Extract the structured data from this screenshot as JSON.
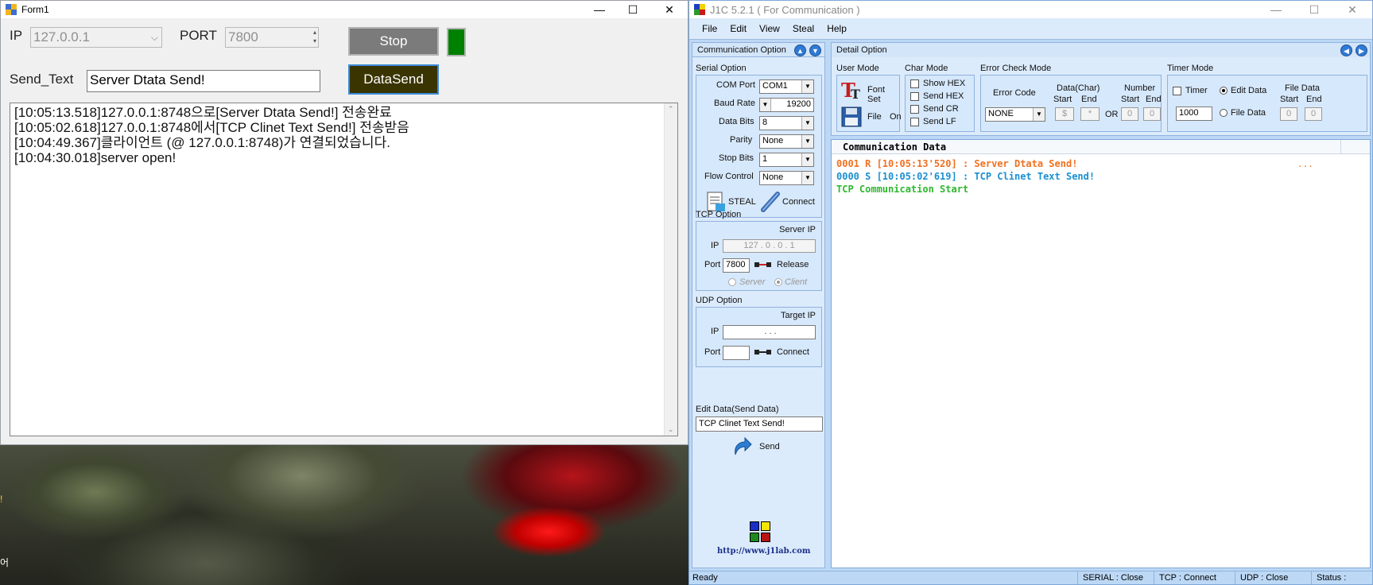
{
  "form1": {
    "title": "Form1",
    "controls": {
      "minimize": "—",
      "maximize": "☐",
      "close": "✕"
    },
    "ip_label": "IP",
    "ip_value": "127.0.0.1",
    "port_label": "PORT",
    "port_value": "7800",
    "stop_label": "Stop",
    "send_text_label": "Send_Text",
    "send_text_value": "Server Dtata Send!",
    "datasend_label": "DataSend",
    "log": [
      "[10:05:13.518]127.0.0.1:8748으로[Server Dtata Send!] 전송완료",
      "[10:05:02.618]127.0.0.1:8748에서[TCP Clinet Text Send!] 전송받음",
      "[10:04:49.367]클라이언트 (@ 127.0.0.1:8748)가 연결되었습니다.",
      "[10:04:30.018]server open!"
    ],
    "status_indicator_color": "#008000"
  },
  "desktop": {
    "edge_glyph_top": "!",
    "edge_glyph_bottom": "어"
  },
  "j1c": {
    "title": "J1C 5.2.1 ( For Communication )",
    "menu": [
      "File",
      "Edit",
      "View",
      "Steal",
      "Help"
    ],
    "comm_option_title": "Communication Option",
    "serial": {
      "title": "Serial Option",
      "com_port_label": "COM Port",
      "com_port_value": "COM1",
      "baud_label": "Baud Rate",
      "baud_value": "19200",
      "databits_label": "Data Bits",
      "databits_value": "8",
      "parity_label": "Parity",
      "parity_value": "None",
      "stopbits_label": "Stop Bits",
      "stopbits_value": "1",
      "flow_label": "Flow Control",
      "flow_value": "None",
      "steal_label": "STEAL",
      "connect_label": "Connect"
    },
    "tcp": {
      "title": "TCP Option",
      "server_ip_label": "Server IP",
      "ip_label": "IP",
      "ip_value": "127 .  0  .  0  .  1",
      "port_label": "Port",
      "port_value": "7800",
      "release_label": "Release",
      "server_radio": "Server",
      "client_radio": "Client"
    },
    "udp": {
      "title": "UDP Option",
      "target_ip_label": "Target IP",
      "ip_label": "IP",
      "ip_value": ".        .        .",
      "port_label": "Port",
      "port_value": "",
      "connect_label": "Connect"
    },
    "edit_data": {
      "title": "Edit Data(Send Data)",
      "value": "TCP Clinet Text Send!",
      "send_label": "Send"
    },
    "website": "http://www.j1lab.com",
    "detail_option_title": "Detail Option",
    "user_mode": {
      "title": "User Mode",
      "font_set": "Font Set",
      "file": "File",
      "on": "On"
    },
    "char_mode": {
      "title": "Char Mode",
      "items": [
        "Show HEX",
        "Send HEX",
        "Send CR",
        "Send LF"
      ]
    },
    "error_check": {
      "title": "Error Check Mode",
      "error_code_label": "Error Code",
      "error_code_value": "NONE",
      "data_char_label": "Data(Char)",
      "number_label": "Number",
      "start_label": "Start",
      "end_label": "End",
      "or_label": "OR",
      "data_start": "$",
      "data_end": "*",
      "num_start": "0",
      "num_end": "0"
    },
    "timer_mode": {
      "title": "Timer Mode",
      "timer_label": "Timer",
      "edit_data_label": "Edit Data",
      "file_data_label": "File Data",
      "interval": "1000",
      "file_data_title": "File Data",
      "start_label": "Start",
      "end_label": "End",
      "start_value": "0",
      "end_value": "0"
    },
    "comm_data": {
      "title": "Communication Data",
      "lines": [
        {
          "text": "0001 R [10:05:13'520] : Server Dtata Send!",
          "color": "#f07020"
        },
        {
          "text": "0000 S [10:05:02'619] : TCP Clinet Text Send!",
          "color": "#1b8fd0"
        },
        {
          "text": "TCP Communication Start",
          "color": "#2db82d"
        }
      ],
      "ellipsis": "..."
    },
    "statusbar": {
      "ready": "Ready",
      "serial": "SERIAL : Close",
      "tcp": "TCP : Connect",
      "udp": "UDP : Close",
      "status": "Status :"
    }
  }
}
